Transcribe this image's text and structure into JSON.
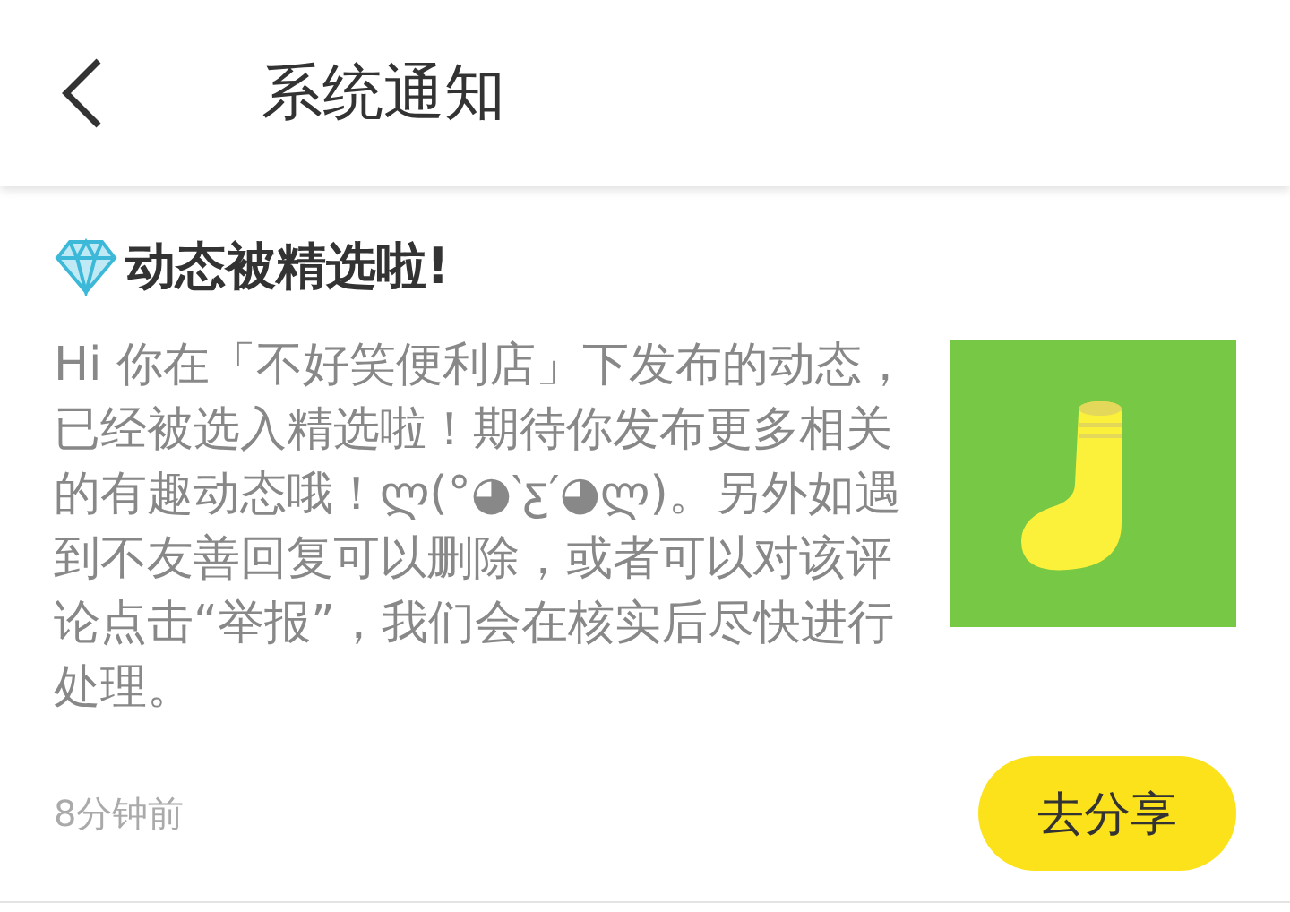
{
  "header": {
    "title": "系统通知"
  },
  "notice": {
    "title": "动态被精选啦!",
    "body": "Hi 你在「不好笑便利店」下发布的动态，已经被选入精选啦！期待你发布更多相关的有趣动态哦！ლ(°◕‵ƹ′◕ლ)。另外如遇到不友善回复可以删除，或者可以对该评论点击“举报”，我们会在核实后尽快进行处理。",
    "time": "8分钟前",
    "button": "去分享"
  }
}
